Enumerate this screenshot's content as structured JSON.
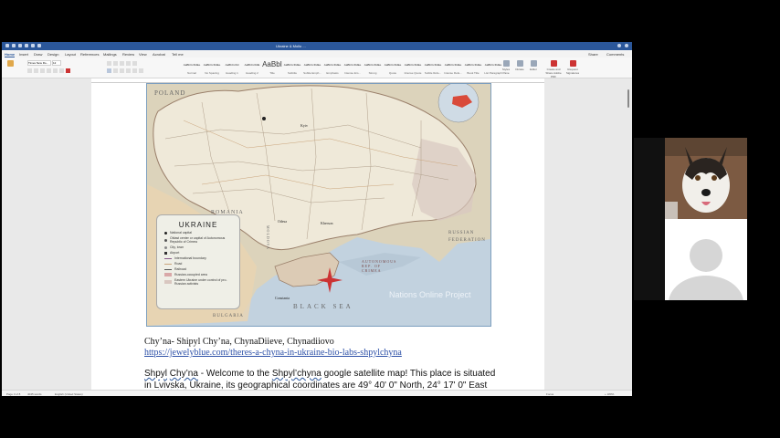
{
  "app": {
    "doc_title": "Ukraine & Mollo ...",
    "tabs": [
      {
        "label": "Home",
        "active": true
      },
      {
        "label": "Insert"
      },
      {
        "label": "Draw"
      },
      {
        "label": "Design"
      },
      {
        "label": "Layout"
      },
      {
        "label": "References"
      },
      {
        "label": "Mailings"
      },
      {
        "label": "Review"
      },
      {
        "label": "View"
      },
      {
        "label": "Acrobat"
      },
      {
        "label": "Tell me"
      }
    ],
    "share_label": "Share",
    "comments_label": "Comments",
    "font_name": "Times New Ro...",
    "font_size": "12",
    "styles": [
      {
        "sample": "AaBbCcDdEe",
        "name": "Normal"
      },
      {
        "sample": "AaBbCcDdEe",
        "name": "No Spacing"
      },
      {
        "sample": "AaBbCcDd",
        "name": "Heading 1"
      },
      {
        "sample": "AaBbCcDdE",
        "name": "Heading 2"
      },
      {
        "sample": "AaBbI",
        "name": "Title",
        "big": true
      },
      {
        "sample": "AaBbCcDdEe",
        "name": "Subtitle"
      },
      {
        "sample": "AaBbCcDdEe",
        "name": "Subtle Emph..."
      },
      {
        "sample": "AaBbCcDdEe",
        "name": "Emphasis"
      },
      {
        "sample": "AaBbCcDdEe",
        "name": "Intense Em..."
      },
      {
        "sample": "AaBbCcDdEe",
        "name": "Strong"
      },
      {
        "sample": "AaBbCcDdEe",
        "name": "Quote"
      },
      {
        "sample": "AaBbCcDdEe",
        "name": "Intense Quote"
      },
      {
        "sample": "AaBbCcDdEe",
        "name": "Subtle Refe..."
      },
      {
        "sample": "AaBbCcDdEe",
        "name": "Intense Refe..."
      },
      {
        "sample": "AaBbCcDdEe",
        "name": "Book Title"
      },
      {
        "sample": "AaBbCcDdEe",
        "name": "List Paragraph"
      }
    ],
    "ribbon_buttons": [
      {
        "label": "Styles Pane"
      },
      {
        "label": "Dictate"
      },
      {
        "label": "Editor"
      },
      {
        "label": "Create and Share Adobe PDF"
      },
      {
        "label": "Request Signatures"
      }
    ],
    "status": {
      "page": "Page 3 of 8",
      "words": "4045 words",
      "lang": "English (United States)",
      "focus": "Focus",
      "zoom": "+ 180%"
    }
  },
  "map": {
    "title": "UKRAINE",
    "legend": [
      "National capital",
      "Oblast center or capital of Autonomous Republic of Crimea",
      "City, town",
      "Airport",
      "International boundary",
      "Road",
      "Railroad",
      "Russian-occupied area",
      "Eastern Ukraine under control of pro-Russian activists"
    ],
    "labels": {
      "poland": "POLAND",
      "romania": "ROMANIA",
      "russian_federation": "RUSSIAN FEDERATION",
      "moldova": "MOLDOVA",
      "bulgaria": "BULGARIA",
      "black_sea": "BLACK SEA",
      "crimea": "AUTONOMOUS REP. OF CRIMEA",
      "kyiv": "Kyiv",
      "odesa": "Odesa",
      "kherson": "Kherson",
      "constanta": "Constanta"
    },
    "watermark": "Nations Online Project"
  },
  "document": {
    "line1": "Chy’na- Shipyl Chy’na, ChynaDiieve, Chynadiiovo",
    "link": "https://jewelyblue.com/theres-a-chyna-in-ukraine-bio-labs-shpylchyna",
    "p1_word1": "Shpyl",
    "p1_word2": "Chy’na",
    "p1_rest": " - Welcome to the ",
    "p1_word3": "Shpyl’chyna",
    "p1_tail": " google satellite map! This place is situated",
    "p2_pre": "in ",
    "p2_word": "Lvivska",
    "p2_tail": ", Ukraine, its geographical coordinates are 49° 40' 0\" North, 24° 17' 0\" East"
  },
  "colors": {
    "word_blue": "#2b579a",
    "link_blue": "#2e51a8",
    "map_sea": "#b7c8d6",
    "map_land": "#e8e2d0"
  }
}
